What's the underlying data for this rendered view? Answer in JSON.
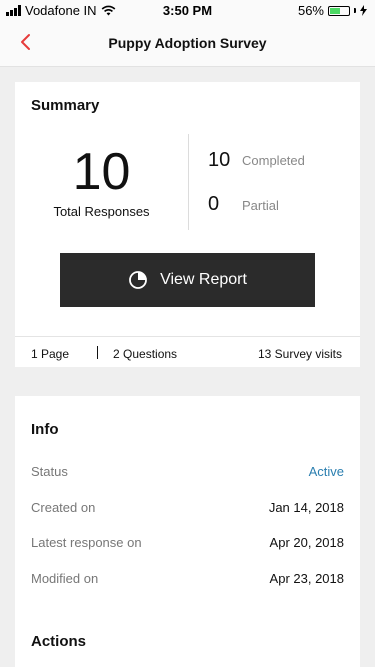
{
  "status_bar": {
    "carrier": "Vodafone IN",
    "time": "3:50 PM",
    "battery_percent": "56%",
    "battery_level": 0.56,
    "icons": [
      "signal-icon",
      "wifi-icon",
      "battery-icon",
      "charging-icon"
    ]
  },
  "nav": {
    "back_icon": "chevron-left-icon",
    "title": "Puppy Adoption Survey",
    "accent_color": "#e63b3b"
  },
  "summary": {
    "title": "Summary",
    "total_responses": "10",
    "total_label": "Total Responses",
    "completed_count": "10",
    "completed_label": "Completed",
    "partial_count": "0",
    "partial_label": "Partial",
    "view_report_label": "View Report",
    "view_report_icon": "pie-chart-icon",
    "pages": "1 Page",
    "questions": "2 Questions",
    "visits": "13 Survey visits"
  },
  "info": {
    "title": "Info",
    "rows": [
      {
        "label": "Status",
        "value": "Active"
      },
      {
        "label": "Created on",
        "value": "Jan 14, 2018"
      },
      {
        "label": "Latest response on",
        "value": "Apr 20, 2018"
      },
      {
        "label": "Modified on",
        "value": "Apr 23, 2018"
      }
    ],
    "status_color": "#2b7fb0"
  },
  "actions": {
    "title": "Actions"
  }
}
